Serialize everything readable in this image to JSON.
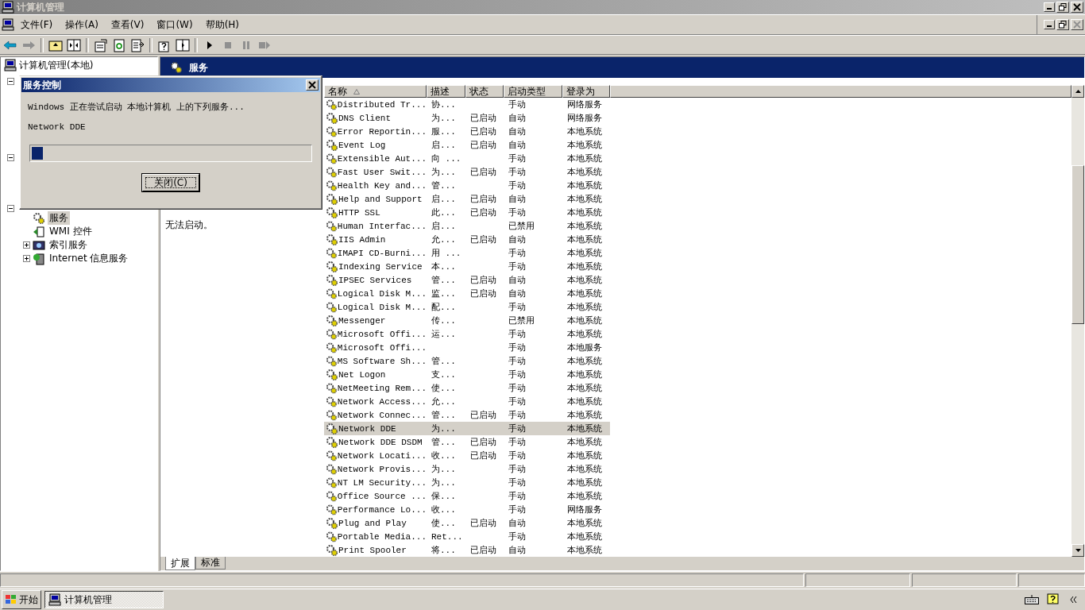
{
  "window": {
    "title": "计算机管理"
  },
  "menu": [
    "文件(F)",
    "操作(A)",
    "查看(V)",
    "窗口(W)",
    "帮助(H)"
  ],
  "tree": {
    "root": "计算机管理(本地)",
    "group_expanders": [
      {
        "expanded": true
      },
      {
        "expanded": true
      },
      {
        "expanded": true
      }
    ],
    "items": [
      {
        "label": "服务",
        "kind": "services",
        "selected": true
      },
      {
        "label": "WMI 控件",
        "kind": "wmi",
        "selected": false
      },
      {
        "label": "索引服务",
        "kind": "index",
        "selected": false,
        "expanded": false
      },
      {
        "label": "Internet 信息服务",
        "kind": "iis",
        "selected": false,
        "expanded": false
      }
    ]
  },
  "panel": {
    "title": "服务",
    "description_fragment": "无法启动。"
  },
  "services": {
    "columns": [
      {
        "label": "名称",
        "sorted": true
      },
      {
        "label": "描述",
        "sorted": false
      },
      {
        "label": "状态",
        "sorted": false
      },
      {
        "label": "启动类型",
        "sorted": false
      },
      {
        "label": "登录为",
        "sorted": false
      }
    ],
    "rows": [
      {
        "name": "Distributed Tr...",
        "description": "协...",
        "status": "",
        "startup": "手动",
        "logon": "网络服务",
        "selected": false
      },
      {
        "name": "DNS Client",
        "description": "为...",
        "status": "已启动",
        "startup": "自动",
        "logon": "网络服务",
        "selected": false
      },
      {
        "name": "Error Reportin...",
        "description": "服...",
        "status": "已启动",
        "startup": "自动",
        "logon": "本地系统",
        "selected": false
      },
      {
        "name": "Event Log",
        "description": "启...",
        "status": "已启动",
        "startup": "自动",
        "logon": "本地系统",
        "selected": false
      },
      {
        "name": "Extensible Aut...",
        "description": "向 ...",
        "status": "",
        "startup": "手动",
        "logon": "本地系统",
        "selected": false
      },
      {
        "name": "Fast User Swit...",
        "description": "为...",
        "status": "已启动",
        "startup": "手动",
        "logon": "本地系统",
        "selected": false
      },
      {
        "name": "Health Key and...",
        "description": "管...",
        "status": "",
        "startup": "手动",
        "logon": "本地系统",
        "selected": false
      },
      {
        "name": "Help and Support",
        "description": "启...",
        "status": "已启动",
        "startup": "自动",
        "logon": "本地系统",
        "selected": false
      },
      {
        "name": "HTTP SSL",
        "description": "此...",
        "status": "已启动",
        "startup": "手动",
        "logon": "本地系统",
        "selected": false
      },
      {
        "name": "Human Interfac...",
        "description": "启...",
        "status": "",
        "startup": "已禁用",
        "logon": "本地系统",
        "selected": false
      },
      {
        "name": "IIS Admin",
        "description": "允...",
        "status": "已启动",
        "startup": "自动",
        "logon": "本地系统",
        "selected": false
      },
      {
        "name": "IMAPI CD-Burni...",
        "description": "用 ...",
        "status": "",
        "startup": "手动",
        "logon": "本地系统",
        "selected": false
      },
      {
        "name": "Indexing Service",
        "description": "本...",
        "status": "",
        "startup": "手动",
        "logon": "本地系统",
        "selected": false
      },
      {
        "name": "IPSEC Services",
        "description": "管...",
        "status": "已启动",
        "startup": "自动",
        "logon": "本地系统",
        "selected": false
      },
      {
        "name": "Logical Disk M...",
        "description": "监...",
        "status": "已启动",
        "startup": "自动",
        "logon": "本地系统",
        "selected": false
      },
      {
        "name": "Logical Disk M...",
        "description": "配...",
        "status": "",
        "startup": "手动",
        "logon": "本地系统",
        "selected": false
      },
      {
        "name": "Messenger",
        "description": "传...",
        "status": "",
        "startup": "已禁用",
        "logon": "本地系统",
        "selected": false
      },
      {
        "name": "Microsoft Offi...",
        "description": "运...",
        "status": "",
        "startup": "手动",
        "logon": "本地系统",
        "selected": false
      },
      {
        "name": "Microsoft Offi...",
        "description": "",
        "status": "",
        "startup": "手动",
        "logon": "本地服务",
        "selected": false
      },
      {
        "name": "MS Software Sh...",
        "description": "管...",
        "status": "",
        "startup": "手动",
        "logon": "本地系统",
        "selected": false
      },
      {
        "name": "Net Logon",
        "description": "支...",
        "status": "",
        "startup": "手动",
        "logon": "本地系统",
        "selected": false
      },
      {
        "name": "NetMeeting Rem...",
        "description": "使...",
        "status": "",
        "startup": "手动",
        "logon": "本地系统",
        "selected": false
      },
      {
        "name": "Network Access...",
        "description": "允...",
        "status": "",
        "startup": "手动",
        "logon": "本地系统",
        "selected": false
      },
      {
        "name": "Network Connec...",
        "description": "管...",
        "status": "已启动",
        "startup": "手动",
        "logon": "本地系统",
        "selected": false
      },
      {
        "name": "Network DDE",
        "description": "为...",
        "status": "",
        "startup": "手动",
        "logon": "本地系统",
        "selected": true
      },
      {
        "name": "Network DDE DSDM",
        "description": "管...",
        "status": "已启动",
        "startup": "手动",
        "logon": "本地系统",
        "selected": false
      },
      {
        "name": "Network Locati...",
        "description": "收...",
        "status": "已启动",
        "startup": "手动",
        "logon": "本地系统",
        "selected": false
      },
      {
        "name": "Network Provis...",
        "description": "为...",
        "status": "",
        "startup": "手动",
        "logon": "本地系统",
        "selected": false
      },
      {
        "name": "NT LM Security...",
        "description": "为...",
        "status": "",
        "startup": "手动",
        "logon": "本地系统",
        "selected": false
      },
      {
        "name": "Office Source ...",
        "description": "保...",
        "status": "",
        "startup": "手动",
        "logon": "本地系统",
        "selected": false
      },
      {
        "name": "Performance Lo...",
        "description": "收...",
        "status": "",
        "startup": "手动",
        "logon": "网络服务",
        "selected": false
      },
      {
        "name": "Plug and Play",
        "description": "使...",
        "status": "已启动",
        "startup": "自动",
        "logon": "本地系统",
        "selected": false
      },
      {
        "name": "Portable Media...",
        "description": "Ret...",
        "status": "",
        "startup": "手动",
        "logon": "本地系统",
        "selected": false
      },
      {
        "name": "Print Spooler",
        "description": "将...",
        "status": "已启动",
        "startup": "自动",
        "logon": "本地系统",
        "selected": false
      }
    ]
  },
  "tabs": [
    {
      "label": "扩展",
      "selected": true
    },
    {
      "label": "标准",
      "selected": false
    }
  ],
  "dialog": {
    "title": "服务控制",
    "message": "Windows 正在尝试启动 本地计算机 上的下列服务...",
    "service": "Network DDE",
    "progress": {
      "level": 0.04
    },
    "button": "关闭(C)"
  },
  "taskbar": {
    "start": "开始",
    "tasks": [
      {
        "label": "计算机管理",
        "selected": true
      }
    ]
  }
}
